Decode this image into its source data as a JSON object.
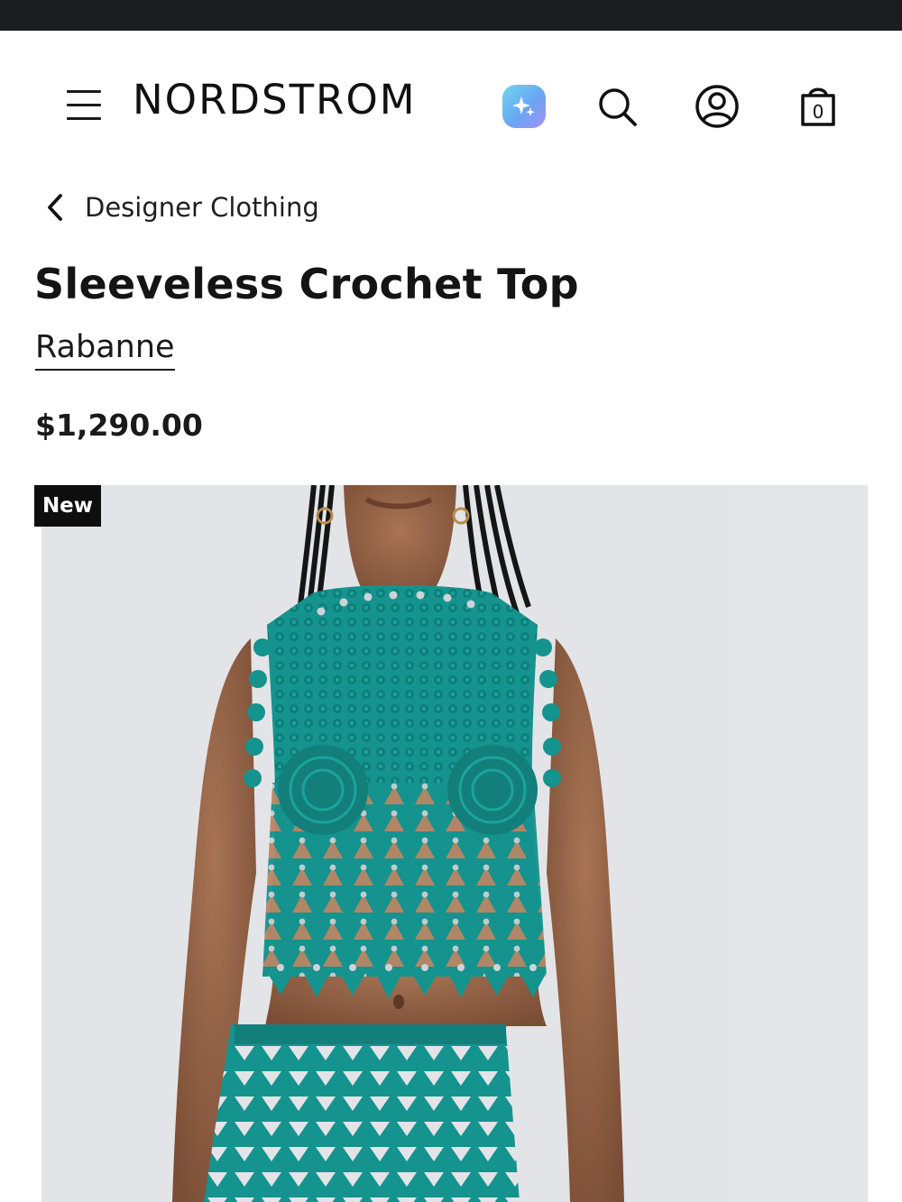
{
  "header": {
    "brand_logo": "NORDSTROM",
    "icons": {
      "menu": "menu-icon",
      "ai_assistant": "sparkle-icon",
      "search": "search-icon",
      "account": "account-icon",
      "bag": "shopping-bag-icon"
    },
    "bag_count": "0"
  },
  "breadcrumb": {
    "back_label": "Designer Clothing"
  },
  "product": {
    "title": "Sleeveless Crochet Top",
    "brand": "Rabanne",
    "price": "$1,290.00",
    "badge": "New"
  },
  "colors": {
    "top_strip": "#1b1c20",
    "badge_bg": "#0e0e0e",
    "garment_teal": "#15938e",
    "image_bg": "#e3e4e7"
  }
}
